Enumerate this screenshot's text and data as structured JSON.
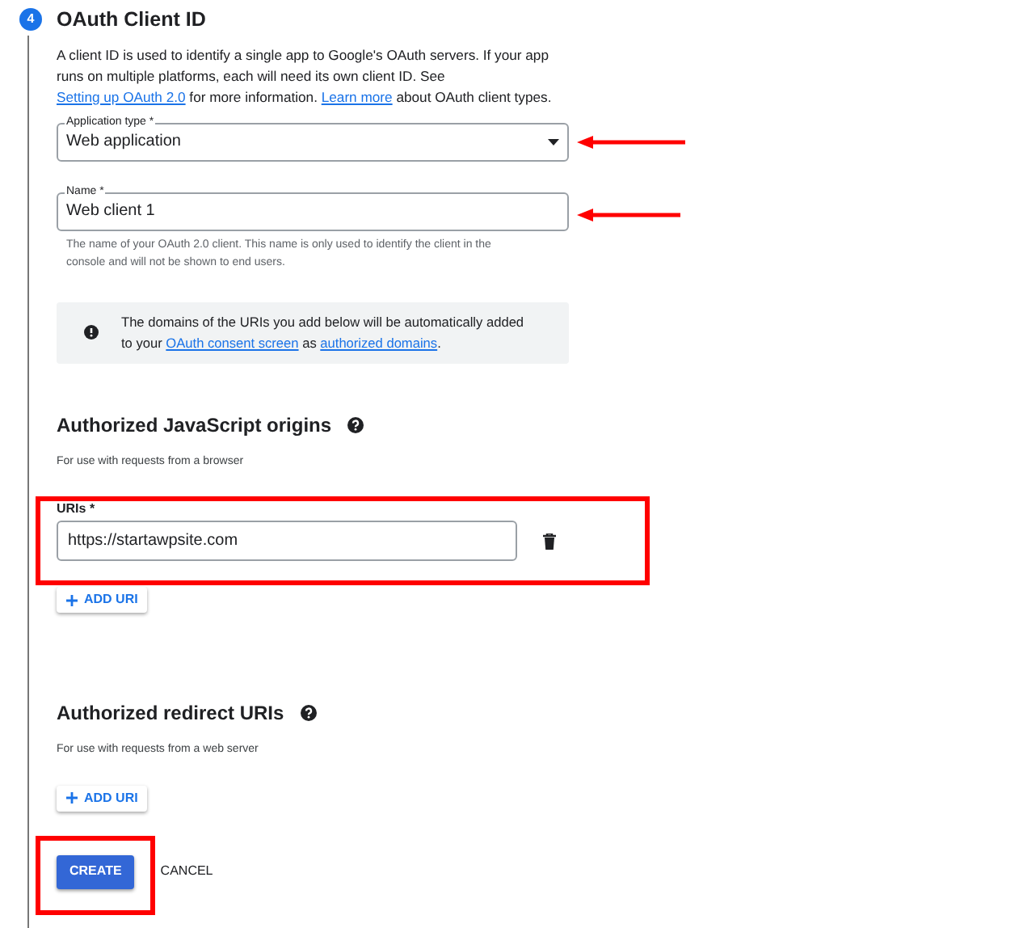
{
  "step": {
    "number": "4",
    "title": "OAuth Client ID"
  },
  "description": [
    {
      "text": "A client ID is used to identify a single app to Google's OAuth servers. If your app runs on multiple platforms, each will need its own client ID. See ",
      "link": false
    },
    {
      "text": "Setting up OAuth 2.0",
      "link": true
    },
    {
      "text": " for more information. ",
      "link": false
    },
    {
      "text": "Learn more",
      "link": true
    },
    {
      "text": " about OAuth client types.",
      "link": false
    }
  ],
  "application_type": {
    "label": "Application type *",
    "value": "Web application"
  },
  "name_field": {
    "label": "Name *",
    "value": "Web client 1",
    "helper": "The name of your OAuth 2.0 client. This name is only used to identify the client in the console and will not be shown to end users."
  },
  "info": [
    {
      "text": "The domains of the URIs you add below will be automatically added to your ",
      "link": false
    },
    {
      "text": "OAuth consent screen",
      "link": true
    },
    {
      "text": " as ",
      "link": false
    },
    {
      "text": "authorized domains",
      "link": true
    },
    {
      "text": ".",
      "link": false
    }
  ],
  "js_origins": {
    "heading": "Authorized JavaScript origins",
    "subtext": "For use with requests from a browser",
    "uris_label": "URIs *",
    "uris": [
      "https://startawpsite.com"
    ],
    "add_button": "ADD URI"
  },
  "redirect_uris": {
    "heading": "Authorized redirect URIs",
    "subtext": "For use with requests from a web server",
    "add_button": "ADD URI"
  },
  "buttons": [
    {
      "label": "CREATE",
      "kind": "primary"
    },
    {
      "label": "CANCEL",
      "kind": "text"
    }
  ]
}
